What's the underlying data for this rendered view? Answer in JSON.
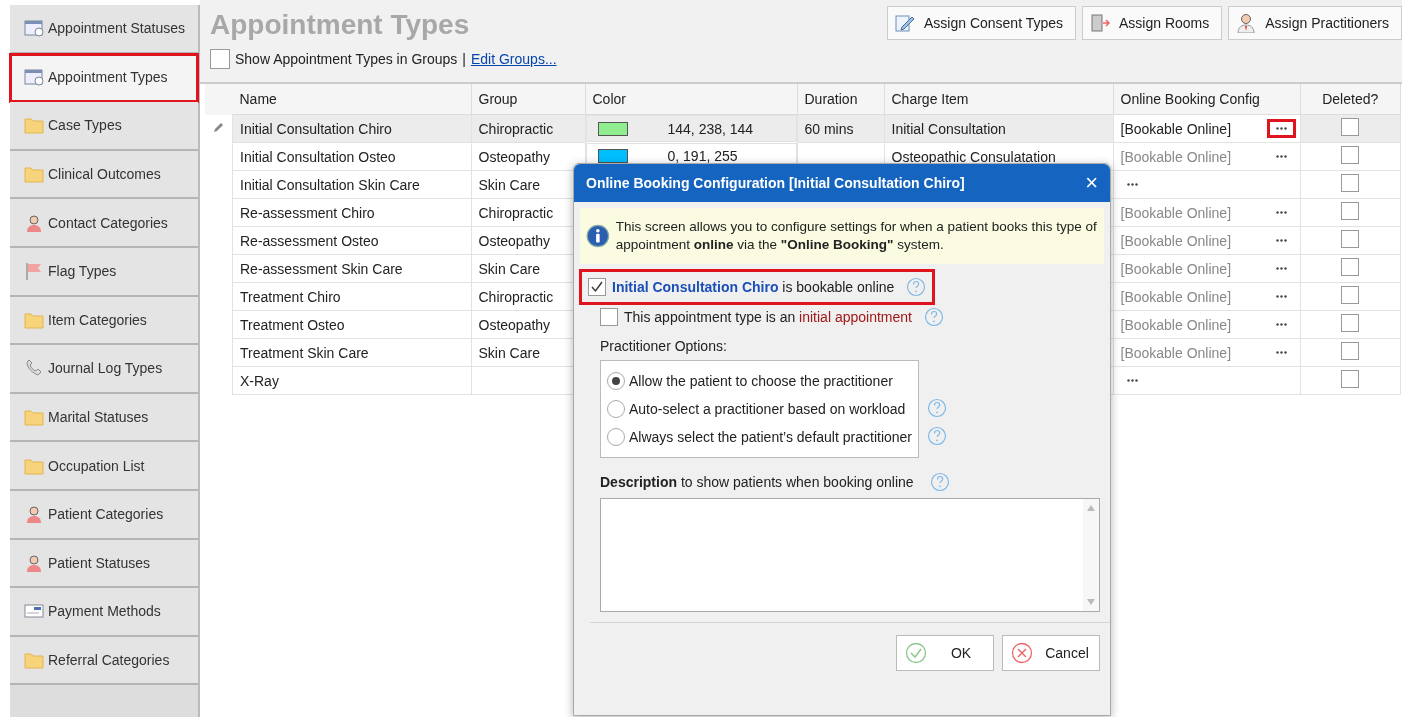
{
  "sidebar": {
    "items": [
      {
        "label": "Appointment Statuses",
        "kind": "calendar",
        "selected": false,
        "highlighted": false
      },
      {
        "label": "Appointment Types",
        "kind": "calendar",
        "selected": true,
        "highlighted": true
      },
      {
        "label": "Case Types",
        "kind": "folder",
        "selected": false,
        "highlighted": false
      },
      {
        "label": "Clinical Outcomes",
        "kind": "folder",
        "selected": false,
        "highlighted": false
      },
      {
        "label": "Contact Categories",
        "kind": "person",
        "selected": false,
        "highlighted": false
      },
      {
        "label": "Flag Types",
        "kind": "flag",
        "selected": false,
        "highlighted": false
      },
      {
        "label": "Item Categories",
        "kind": "folder",
        "selected": false,
        "highlighted": false
      },
      {
        "label": "Journal Log Types",
        "kind": "phone",
        "selected": false,
        "highlighted": false
      },
      {
        "label": "Marital Statuses",
        "kind": "folder",
        "selected": false,
        "highlighted": false
      },
      {
        "label": "Occupation List",
        "kind": "folder",
        "selected": false,
        "highlighted": false
      },
      {
        "label": "Patient Categories",
        "kind": "person",
        "selected": false,
        "highlighted": false
      },
      {
        "label": "Patient Statuses",
        "kind": "person",
        "selected": false,
        "highlighted": false
      },
      {
        "label": "Payment Methods",
        "kind": "card",
        "selected": false,
        "highlighted": false
      },
      {
        "label": "Referral Categories",
        "kind": "folder",
        "selected": false,
        "highlighted": false
      }
    ]
  },
  "page": {
    "title": "Appointment Types",
    "toolbar": [
      {
        "label": "Assign Consent Types",
        "kind": "consent"
      },
      {
        "label": "Assign Rooms",
        "kind": "door"
      },
      {
        "label": "Assign Practitioners",
        "kind": "person"
      }
    ],
    "show_groups": {
      "label": "Show Appointment Types in Groups",
      "checked": false
    },
    "separator": "|",
    "edit_groups_link": "Edit Groups..."
  },
  "table": {
    "columns": [
      "Name",
      "Group",
      "Color",
      "Duration",
      "Charge Item",
      "Online Booking Config",
      "Deleted?"
    ],
    "rows": [
      {
        "name": "Initial Consultation Chiro",
        "group": "Chiropractic",
        "color": "#90ee90",
        "color_text": "144, 238, 144",
        "duration": "60 mins",
        "charge_item": "Initial Consultation",
        "config": "[Bookable Online]",
        "config_highlighted": true,
        "deleted": false,
        "selected": true
      },
      {
        "name": "Initial Consultation Osteo",
        "group": "Osteopathy",
        "color": "#00bfff",
        "color_text": "0, 191, 255",
        "charge_item": "Osteopathic Consulatation",
        "config": "[Bookable Online]",
        "config_highlighted": false,
        "deleted": false,
        "selected": false
      },
      {
        "name": "Initial Consultation Skin Care",
        "group": "Skin Care",
        "config_highlighted": false,
        "deleted": false,
        "selected": false
      },
      {
        "name": "Re-assessment Chiro",
        "group": "Chiropractic",
        "config": "[Bookable Online]",
        "config_highlighted": false,
        "deleted": false,
        "selected": false
      },
      {
        "name": "Re-assessment Osteo",
        "group": "Osteopathy",
        "config": "[Bookable Online]",
        "config_highlighted": false,
        "deleted": false,
        "selected": false
      },
      {
        "name": "Re-assessment Skin Care",
        "group": "Skin Care",
        "config": "[Bookable Online]",
        "config_highlighted": false,
        "deleted": false,
        "selected": false
      },
      {
        "name": "Treatment Chiro",
        "group": "Chiropractic",
        "config": "[Bookable Online]",
        "config_highlighted": false,
        "deleted": false,
        "selected": false
      },
      {
        "name": "Treatment Osteo",
        "group": "Osteopathy",
        "config": "[Bookable Online]",
        "config_highlighted": false,
        "deleted": false,
        "selected": false
      },
      {
        "name": "Treatment Skin Care",
        "group": "Skin Care",
        "config": "[Bookable Online]",
        "config_highlighted": false,
        "deleted": false,
        "selected": false
      },
      {
        "name": "X-Ray",
        "group": "",
        "config_highlighted": false,
        "deleted": false,
        "selected": false
      }
    ]
  },
  "dialog": {
    "title": "Online Booking Configuration [Initial Consultation Chiro]",
    "close": "×",
    "info": "This screen allows you to configure settings for when a patient books this type of appointment **online** via the **\"Online Booking\"** system.",
    "checkboxes": [
      {
        "parts": [
          {
            "text": "Initial Consultation Chiro",
            "kind": "name"
          },
          {
            "text": " is bookable online",
            "kind": "plain"
          }
        ],
        "checked": true,
        "highlighted": true
      },
      {
        "parts": [
          {
            "text": "This appointment type is an ",
            "kind": "plain"
          },
          {
            "text": "initial appointment",
            "kind": "term"
          }
        ],
        "checked": false,
        "highlighted": false
      }
    ],
    "practitioner_label": "Practitioner Options:",
    "practitioner_options": [
      {
        "label": "Allow the patient to choose the practitioner",
        "selected": true,
        "help": false
      },
      {
        "label": "Auto-select a practitioner based on workload",
        "selected": false,
        "help": true
      },
      {
        "label": "Always select the patient’s default practitioner",
        "selected": false,
        "help": true
      }
    ],
    "description_label": "**Description** to show patients when booking online",
    "buttons": [
      {
        "label": "OK",
        "kind": "ok"
      },
      {
        "label": "Cancel",
        "kind": "cancel"
      }
    ]
  }
}
